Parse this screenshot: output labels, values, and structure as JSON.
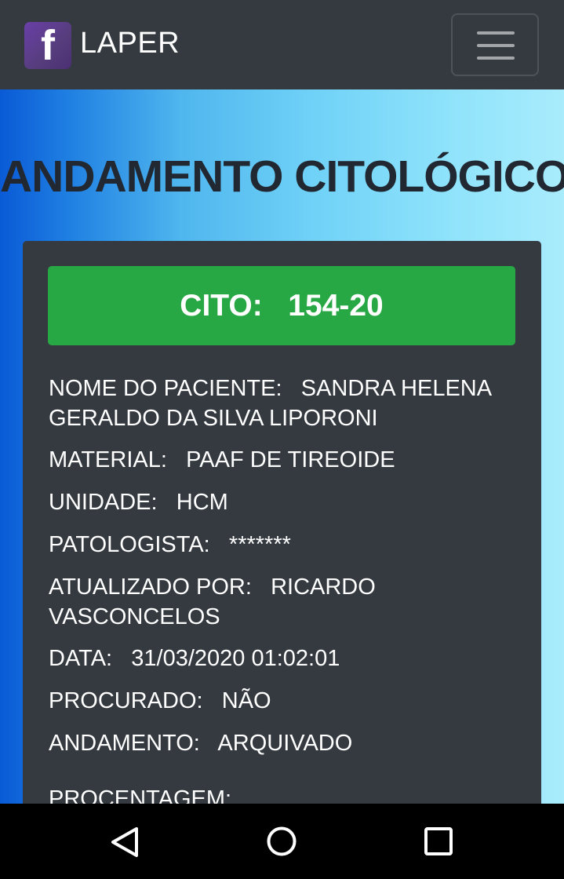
{
  "navbar": {
    "logo_letter": "f",
    "brand": "LAPER"
  },
  "page_title": "ANDAMENTO CITOLÓGICO",
  "card": {
    "cito_label": "CITO:",
    "cito_value": "154-20",
    "fields": [
      {
        "label": "NOME DO PACIENTE:",
        "value": "SANDRA HELENA GERALDO DA SILVA LIPORONI"
      },
      {
        "label": "MATERIAL:",
        "value": "PAAF DE TIREOIDE"
      },
      {
        "label": "UNIDADE:",
        "value": "HCM"
      },
      {
        "label": "PATOLOGISTA:",
        "value": "*******"
      },
      {
        "label": "ATUALIZADO POR:",
        "value": "RICARDO VASCONCELOS"
      },
      {
        "label": "DATA:",
        "value": "31/03/2020 01:02:01"
      },
      {
        "label": "PROCURADO:",
        "value": "NÃO"
      },
      {
        "label": "ANDAMENTO:",
        "value": "ARQUIVADO"
      },
      {
        "label": "PROCENTAGEM:",
        "value": ""
      }
    ]
  },
  "system_nav": {
    "back_icon": "back-triangle-icon",
    "home_icon": "home-circle-icon",
    "recents_icon": "recents-square-icon"
  },
  "colors": {
    "navbar_bg": "#343a40",
    "card_bg": "#343a40",
    "badge_green": "#28a745",
    "logo_purple": "#563d7c"
  }
}
